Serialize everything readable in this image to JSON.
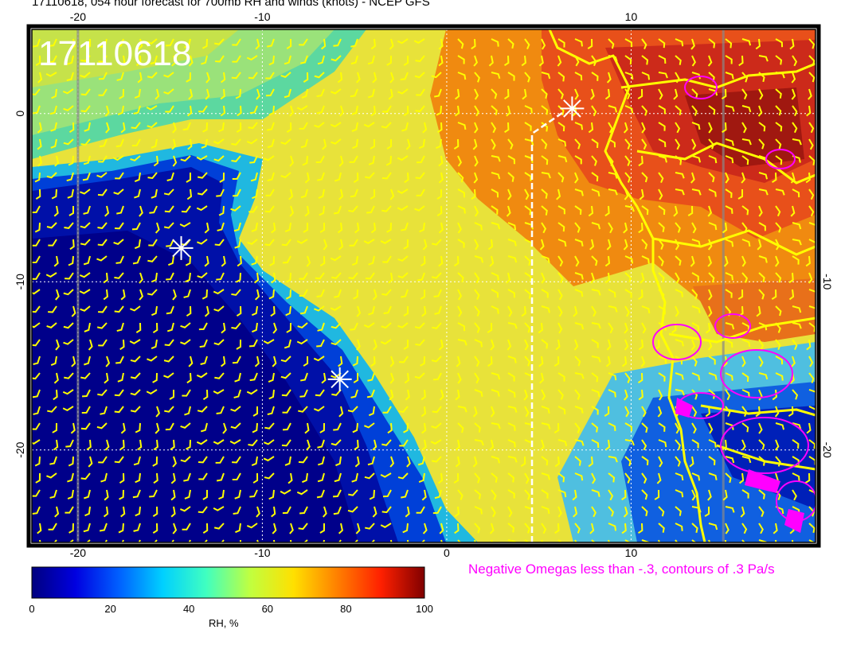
{
  "title": "17110618, 054 hour forecast for 700mb RH and winds (knots) - NCEP GFS",
  "stamp": "17110618",
  "map": {
    "x_ticks_top": [
      "-20",
      "-10",
      "10"
    ],
    "x_ticks_bottom": [
      "-20",
      "-10",
      "0",
      "10"
    ],
    "y_ticks_left": [
      "0",
      "-10",
      "-20"
    ],
    "y_ticks_right": [
      "-10",
      "-20"
    ],
    "lon_range": [
      -22.5,
      20
    ],
    "lat_range": [
      -25.5,
      5
    ],
    "wind_barb_color": "#ffff00",
    "coastline_color": "#ffff00",
    "omega_contour_color": "#ff00ff",
    "markers": [
      {
        "icon": "star-marker",
        "lon": 6.8,
        "lat": 0.3
      },
      {
        "icon": "star-marker",
        "lon": -14.4,
        "lat": -8.0
      },
      {
        "icon": "star-marker",
        "lon": -5.8,
        "lat": -15.8
      }
    ]
  },
  "omega_note": "Negative Omegas less than -.3, contours of .3 Pa/s",
  "colorbar": {
    "label": "RH, %",
    "ticks": [
      "0",
      "20",
      "40",
      "60",
      "80",
      "100"
    ],
    "colors": [
      "#00007f",
      "#0000e0",
      "#0060ff",
      "#00d0ff",
      "#40ffc0",
      "#c0ff40",
      "#ffe000",
      "#ff8000",
      "#ff2000",
      "#800000"
    ]
  }
}
